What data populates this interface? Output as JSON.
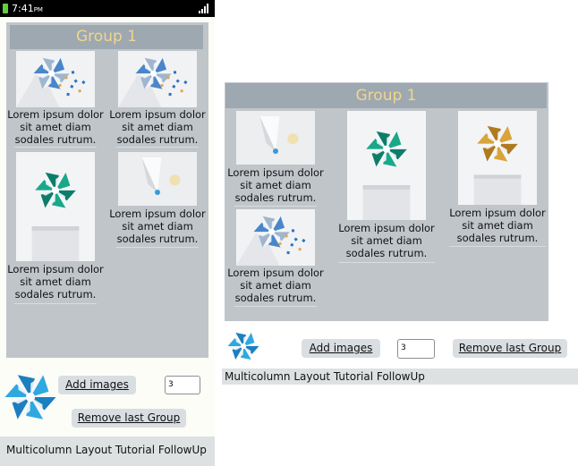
{
  "status": {
    "time": "7:41",
    "ampm": "PM"
  },
  "group_title": "Group 1",
  "caption": "Lorem ipsum dolor sit amet diam sodales rutrum.",
  "caption_lines": [
    "Lorem ipsum dolor",
    "sit amet diam",
    "sodales rutrum."
  ],
  "buttons": {
    "add_images": "Add images",
    "remove_last_group": "Remove last Group"
  },
  "count_field": "3",
  "footer_text": "Multicolumn Layout Tutorial FollowUp",
  "colors": {
    "teal": "#1aa88a",
    "blue": "#2fa8e0",
    "gold": "#d9a43a",
    "header_text": "#f0d68c"
  }
}
